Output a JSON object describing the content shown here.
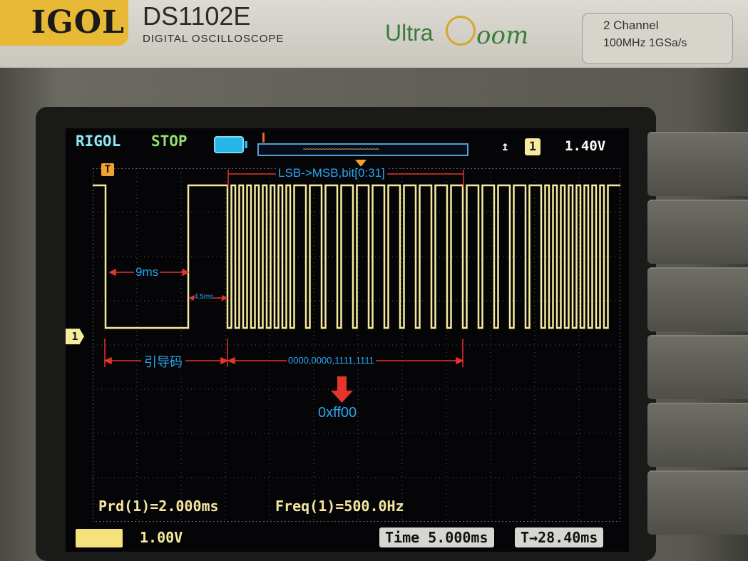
{
  "device": {
    "brand": "IGOL",
    "model": "DS1102E",
    "model_subtitle": "DIGITAL OSCILLOSCOPE",
    "series_prefix": "Ultra",
    "series_suffix": "oom",
    "spec_line1": "2 Channel",
    "spec_line2": "100MHz 1GSa/s"
  },
  "status": {
    "logo": "RIGOL",
    "run_state": "STOP",
    "trigger_slope_symbol": "↥",
    "trigger_channel": "1",
    "trigger_level": "1.40V"
  },
  "markers": {
    "trigger_position": "T",
    "channel_ground": "1"
  },
  "annotations": {
    "bit_order": "LSB->MSB,bit[0:31]",
    "lead_low": "9ms",
    "lead_high": "4.5ms",
    "leader_label": "引导码",
    "data_bits": "0000,0000,1111,1111",
    "result": "0xff00"
  },
  "measurements": {
    "period": "Prd(1)=2.000ms",
    "frequency": "Freq(1)=500.0Hz"
  },
  "bottom_bar": {
    "ch1_scale": "1.00V",
    "timebase": "Time 5.000ms",
    "trigger_offset": "T→28.40ms"
  },
  "colors": {
    "trace": "#f6eb9c",
    "annotation": "#28a8f0",
    "arrow": "#e5352a",
    "status_logo": "#8fe6f3",
    "run_state": "#8fe06a"
  }
}
